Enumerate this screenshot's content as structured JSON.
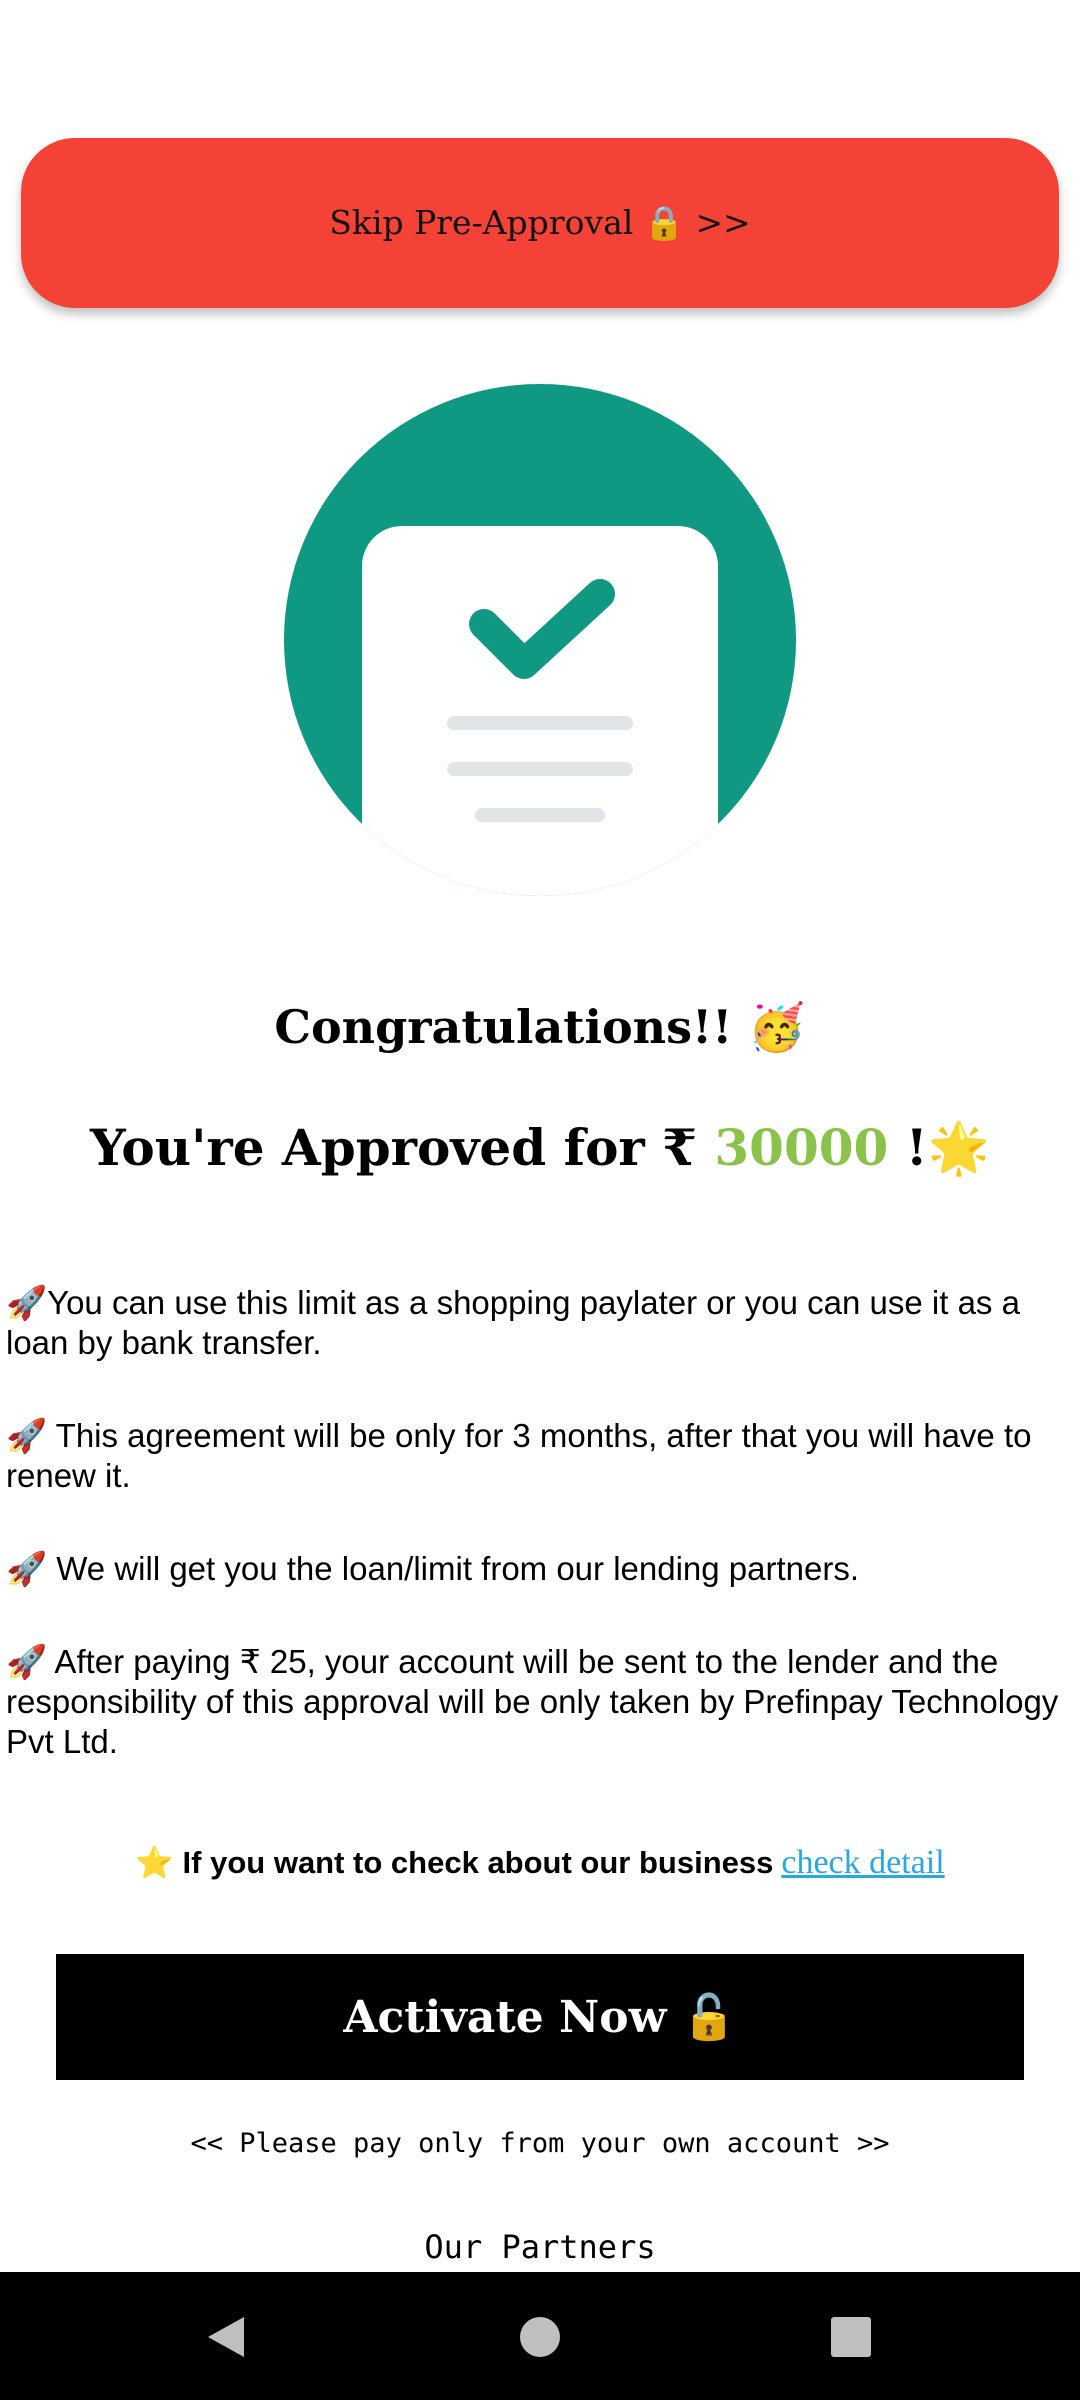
{
  "skip_button": {
    "label": "Skip Pre-Approval 🔒 >>"
  },
  "congrats": {
    "text": "Congratulations!! 🥳"
  },
  "approval": {
    "prefix": "You're Approved for ₹ ",
    "amount": "30000",
    "suffix": " !🌟"
  },
  "points": [
    "🚀You can use this limit as a shopping paylater or you can use it as a loan by bank transfer.",
    "🚀 This agreement will be only for 3 months, after that you will have to renew it.",
    "🚀 We will get you the loan/limit from our lending partners.",
    "🚀 After paying ₹ 25, your account will be sent to the lender and the responsibility of this approval will be only taken by Prefinpay Technology Pvt Ltd."
  ],
  "business": {
    "text": "⭐ If you want to check about our business",
    "link": "check detail "
  },
  "activate_button": {
    "label": "Activate Now 🔓"
  },
  "note": "<< Please pay only from your own account >>",
  "partners_title": "Our Partners",
  "colors": {
    "skip_bg": "#f44336",
    "hero_circle": "#0f9882",
    "amount": "#8bc34a",
    "link": "#29a8e0"
  },
  "icons": {
    "hero": "approved-document-check-icon",
    "nav": [
      "back-icon",
      "home-icon",
      "recents-icon"
    ]
  }
}
